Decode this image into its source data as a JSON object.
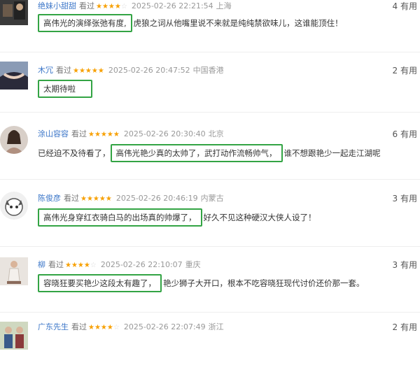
{
  "comments": [
    {
      "username": "绝妹小甜甜",
      "seen_label": "看过",
      "stars_on": "★★★★",
      "stars_off": "☆",
      "time": "2025-02-26 22:21:54",
      "location": "上海",
      "useful": "4 有用",
      "highlight": "高伟光的演绎张弛有度,",
      "rest": "虎狼之词从他嘴里说不来就是纯纯禁欲味儿，这谁能顶住！"
    },
    {
      "username": "木冗",
      "seen_label": "看过",
      "stars_on": "★★★★★",
      "stars_off": "",
      "time": "2025-02-26 20:47:52",
      "location": "中国香港",
      "useful": "2 有用",
      "highlight": "太期待啦",
      "rest": ""
    },
    {
      "username": "涂山容容",
      "seen_label": "看过",
      "stars_on": "★★★★★",
      "stars_off": "",
      "time": "2025-02-26 20:30:40",
      "location": "北京",
      "useful": "6 有用",
      "before": "已经迫不及待看了，",
      "highlight": "高伟光艳少真的太帅了，武打动作流畅帅气，",
      "rest": "谁不想跟艳少一起走江湖呢"
    },
    {
      "username": "陈俊彦",
      "seen_label": "看过",
      "stars_on": "★★★★★",
      "stars_off": "",
      "time": "2025-02-26 20:46:19",
      "location": "内蒙古",
      "useful": "3 有用",
      "highlight": "高伟光身穿红衣骑白马的出场真的帅爆了，",
      "rest": "好久不见这种硬汉大侠人设了！"
    },
    {
      "username": "柳",
      "seen_label": "看过",
      "stars_on": "★★★★",
      "stars_off": "☆",
      "time": "2025-02-26 22:10:07",
      "location": "重庆",
      "useful": "3 有用",
      "highlight": "容晓狂要买艳少这段太有趣了，",
      "rest": "艳少狮子大开口，根本不吃容晓狂现代讨价还价那一套。"
    },
    {
      "username": "广东先生",
      "seen_label": "看过",
      "stars_on": "★★★★",
      "stars_off": "☆",
      "time": "2025-02-26 22:07:49",
      "location": "浙江",
      "useful": "2 有用"
    }
  ],
  "colors": {
    "username": "#3b76c8",
    "star": "#f7a000",
    "highlight_border": "#33a444"
  }
}
